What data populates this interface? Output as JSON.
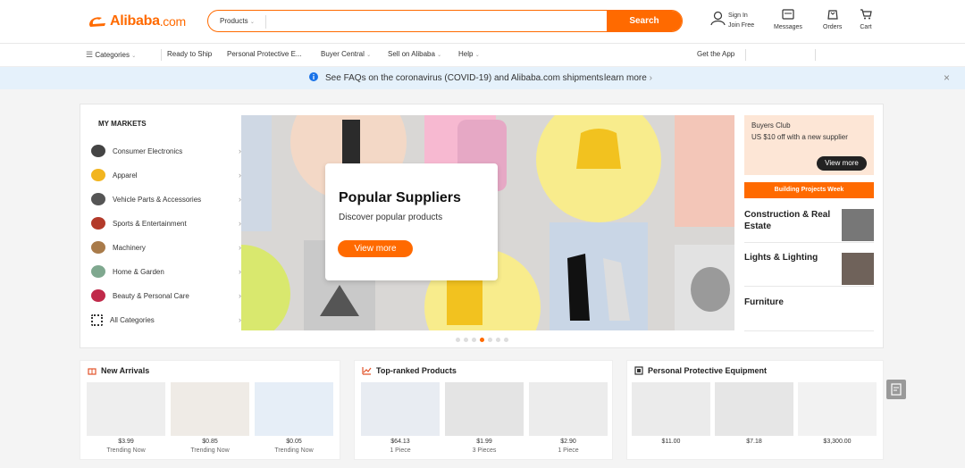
{
  "header": {
    "logo_text": "Alibaba",
    "logo_suffix": ".com",
    "search_category": "Products",
    "search_placeholder": "",
    "search_button": "Search",
    "sign_in": "Sign In",
    "join_free": "Join Free",
    "messages": "Messages",
    "orders": "Orders",
    "cart": "Cart"
  },
  "nav": {
    "categories": "Categories",
    "items": [
      "Ready to Ship",
      "Personal Protective E...",
      "Buyer Central",
      "Sell on Alibaba",
      "Help"
    ],
    "get_app": "Get the App"
  },
  "notice": {
    "text": "See FAQs on the coronavirus (COVID-19) and Alibaba.com shipments",
    "link": "learn more"
  },
  "markets": {
    "title": "MY MARKETS",
    "categories": [
      "Consumer Electronics",
      "Apparel",
      "Vehicle Parts & Accessories",
      "Sports & Entertainment",
      "Machinery",
      "Home & Garden",
      "Beauty & Personal Care",
      "All Categories"
    ]
  },
  "hero": {
    "heading": "Popular Suppliers",
    "subheading": "Discover popular products",
    "button": "View more",
    "slide_count": 7,
    "active_slide": 4
  },
  "side": {
    "buyers_club": "Buyers Club",
    "offer": "US $10 off with a new supplier",
    "view_more": "View more",
    "banner": "Building Projects Week",
    "items": [
      "Construction & Real Estate",
      "Lights & Lighting",
      "Furniture"
    ]
  },
  "sections": [
    {
      "title": "New Arrivals",
      "products": [
        {
          "price": "$3.99",
          "sub": "Trending Now"
        },
        {
          "price": "$0.85",
          "sub": "Trending Now"
        },
        {
          "price": "$0.05",
          "sub": "Trending Now"
        }
      ]
    },
    {
      "title": "Top-ranked Products",
      "products": [
        {
          "price": "$64.13",
          "sub": "1 Piece"
        },
        {
          "price": "$1.99",
          "sub": "3 Pieces"
        },
        {
          "price": "$2.90",
          "sub": "1 Piece"
        }
      ]
    },
    {
      "title": "Personal Protective Equipment",
      "products": [
        {
          "price": "$11.00",
          "sub": ""
        },
        {
          "price": "$7.18",
          "sub": ""
        },
        {
          "price": "$3,300.00",
          "sub": ""
        }
      ]
    }
  ],
  "colors": {
    "brand": "#ff6a00",
    "notice_bg": "#e5f1fb",
    "info_icon": "#1a73e8"
  }
}
